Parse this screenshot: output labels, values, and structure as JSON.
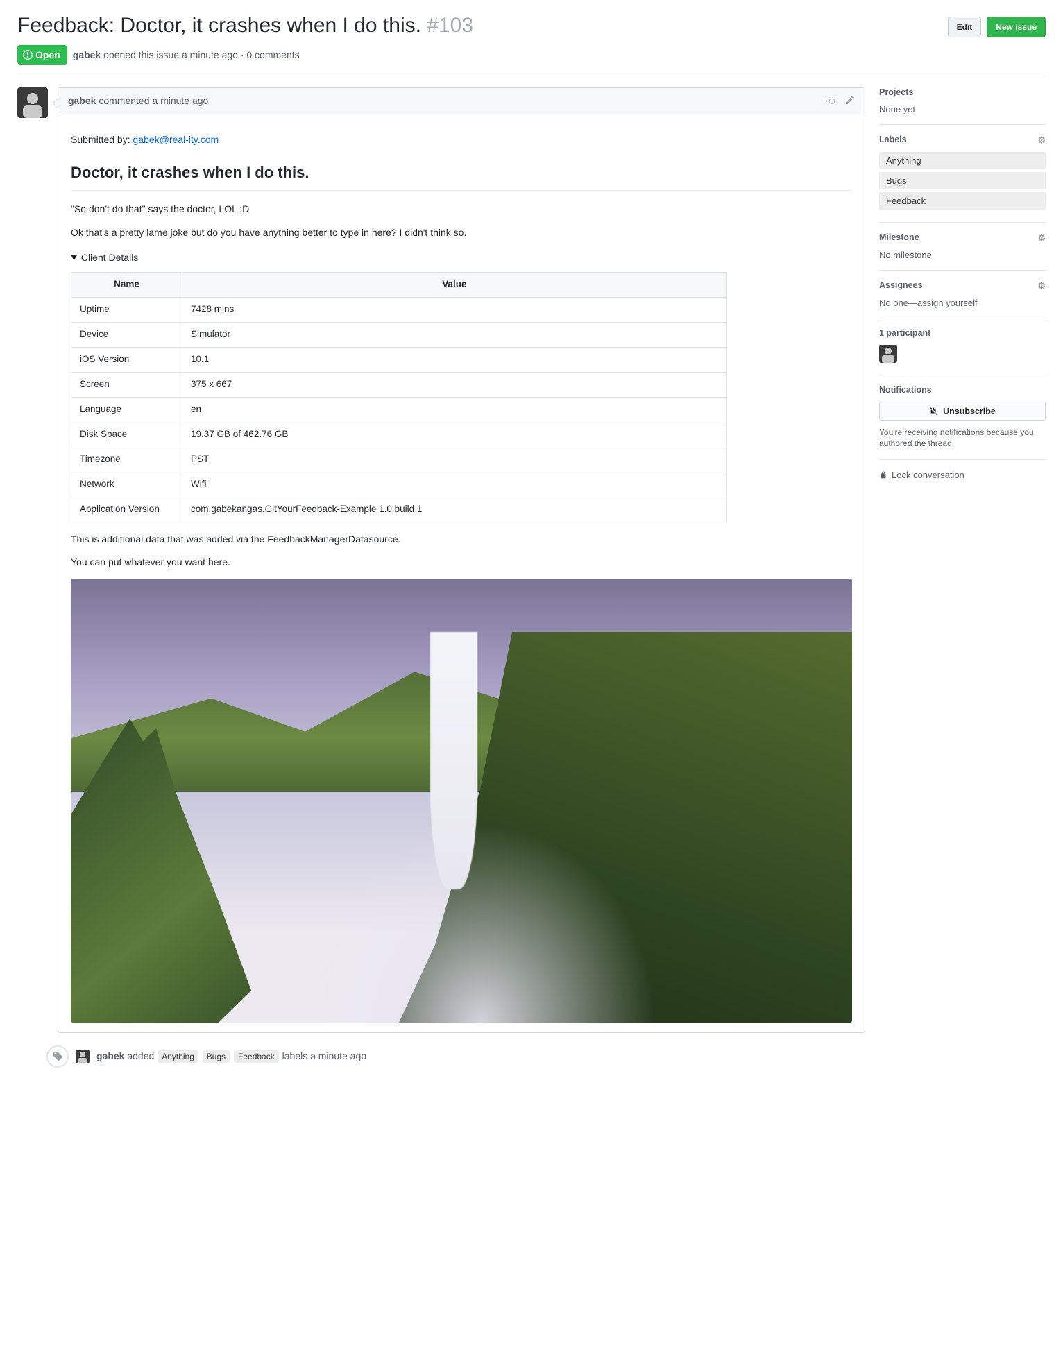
{
  "header": {
    "title_prefix": "Feedback: Doctor, it crashes when I do this.",
    "issue_number": "#103",
    "edit_btn": "Edit",
    "new_issue_btn": "New issue",
    "state": "Open",
    "author": "gabek",
    "opened_text": "opened this issue a minute ago · 0 comments"
  },
  "comment": {
    "author": "gabek",
    "timestamp": "commented a minute ago",
    "submitted_by_label": "Submitted by: ",
    "submitted_by_email": "gabek@real-ity.com",
    "heading": "Doctor, it crashes when I do this.",
    "p1": "\"So don't do that\" says the doctor, LOL :D",
    "p2": "Ok that's a pretty lame joke but do you have anything better to type in here? I didn't think so.",
    "details_summary": "Client Details",
    "table_headers": {
      "name": "Name",
      "value": "Value"
    },
    "table_rows": [
      {
        "name": "Uptime",
        "value": "7428 mins"
      },
      {
        "name": "Device",
        "value": "Simulator"
      },
      {
        "name": "iOS Version",
        "value": "10.1"
      },
      {
        "name": "Screen",
        "value": "375 x 667"
      },
      {
        "name": "Language",
        "value": "en"
      },
      {
        "name": "Disk Space",
        "value": "19.37 GB of 462.76 GB"
      },
      {
        "name": "Timezone",
        "value": "PST"
      },
      {
        "name": "Network",
        "value": "Wifi"
      },
      {
        "name": "Application Version",
        "value": "com.gabekangas.GitYourFeedback-Example 1.0 build 1"
      }
    ],
    "p3": "This is additional data that was added via the FeedbackManagerDatasource.",
    "p4": "You can put whatever you want here."
  },
  "timeline_event": {
    "actor": "gabek",
    "added_text": "added",
    "labels": [
      "Anything",
      "Bugs",
      "Feedback"
    ],
    "suffix": "labels a minute ago"
  },
  "sidebar": {
    "projects": {
      "title": "Projects",
      "value": "None yet"
    },
    "labels": {
      "title": "Labels",
      "items": [
        "Anything",
        "Bugs",
        "Feedback"
      ]
    },
    "milestone": {
      "title": "Milestone",
      "value": "No milestone"
    },
    "assignees": {
      "title": "Assignees",
      "value_prefix": "No one—",
      "assign_link": "assign yourself"
    },
    "participants": {
      "title": "1 participant"
    },
    "notifications": {
      "title": "Notifications",
      "btn": "Unsubscribe",
      "text": "You're receiving notifications because you authored the thread."
    },
    "lock": "Lock conversation"
  }
}
